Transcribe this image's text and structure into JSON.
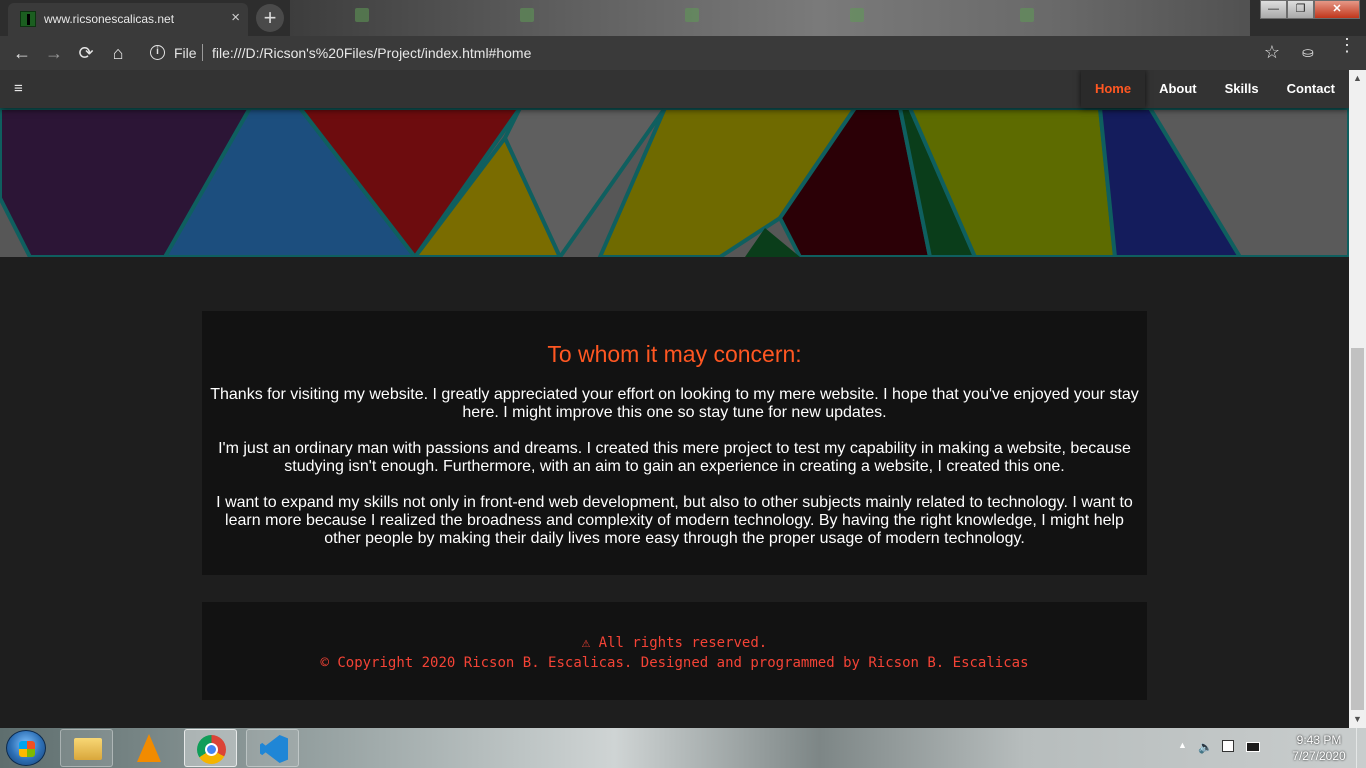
{
  "browser": {
    "tab_title": "www.ricsonescalicas.net",
    "tab_close": "×",
    "new_tab": "+",
    "window_buttons": {
      "minimize": "—",
      "maximize": "❐",
      "close": "✕"
    },
    "nav": {
      "back": "←",
      "forward": "→",
      "reload": "⟳",
      "home": "⌂"
    },
    "address": {
      "info_icon": "i",
      "scheme_label": "File",
      "url": "file:///D:/Ricson's%20Files/Project/index.html#home",
      "bookmark_icon": "☆"
    },
    "extension_icon": "⛀",
    "menu_icon": "⋮"
  },
  "site": {
    "menu_icon": "≡",
    "nav": [
      {
        "label": "Home",
        "active": true
      },
      {
        "label": "About",
        "active": false
      },
      {
        "label": "Skills",
        "active": false
      },
      {
        "label": "Contact",
        "active": false
      }
    ],
    "letter": {
      "heading": "To whom it may concern:",
      "paragraphs": [
        "Thanks for visiting my website. I greatly appreciated your effort on looking to my mere website. I hope that you've enjoyed your stay here. I might improve this one so stay tune for new updates.",
        "I'm just an ordinary man with passions and dreams. I created this mere project to test my capability in making a website, because studying isn't enough. Furthermore, with an aim to gain an experience in creating a website, I created this one.",
        "I want to expand my skills not only in front-end web development, but also to other subjects mainly related to technology. I want to learn more because I realized the broadness and complexity of modern technology. By having the right knowledge, I might help other people by making their daily lives more easy through the proper usage of modern technology."
      ]
    },
    "footer": {
      "line1": "⚠ All rights reserved.",
      "line2": "© Copyright 2020 Ricson B. Escalicas. Designed and programmed by Ricson B. Escalicas"
    },
    "colors": {
      "accent": "#ff5722",
      "footer_text": "#f44336",
      "card_bg": "#121212",
      "page_bg": "#1e1e1e",
      "nav_bg": "#333333"
    }
  },
  "taskbar": {
    "apps": [
      "file-explorer-icon",
      "vlc-icon",
      "chrome-icon",
      "vscode-icon"
    ],
    "tray_arrow": "▲",
    "volume_icon": "🔈",
    "time": "9:43 PM",
    "date": "7/27/2020"
  }
}
